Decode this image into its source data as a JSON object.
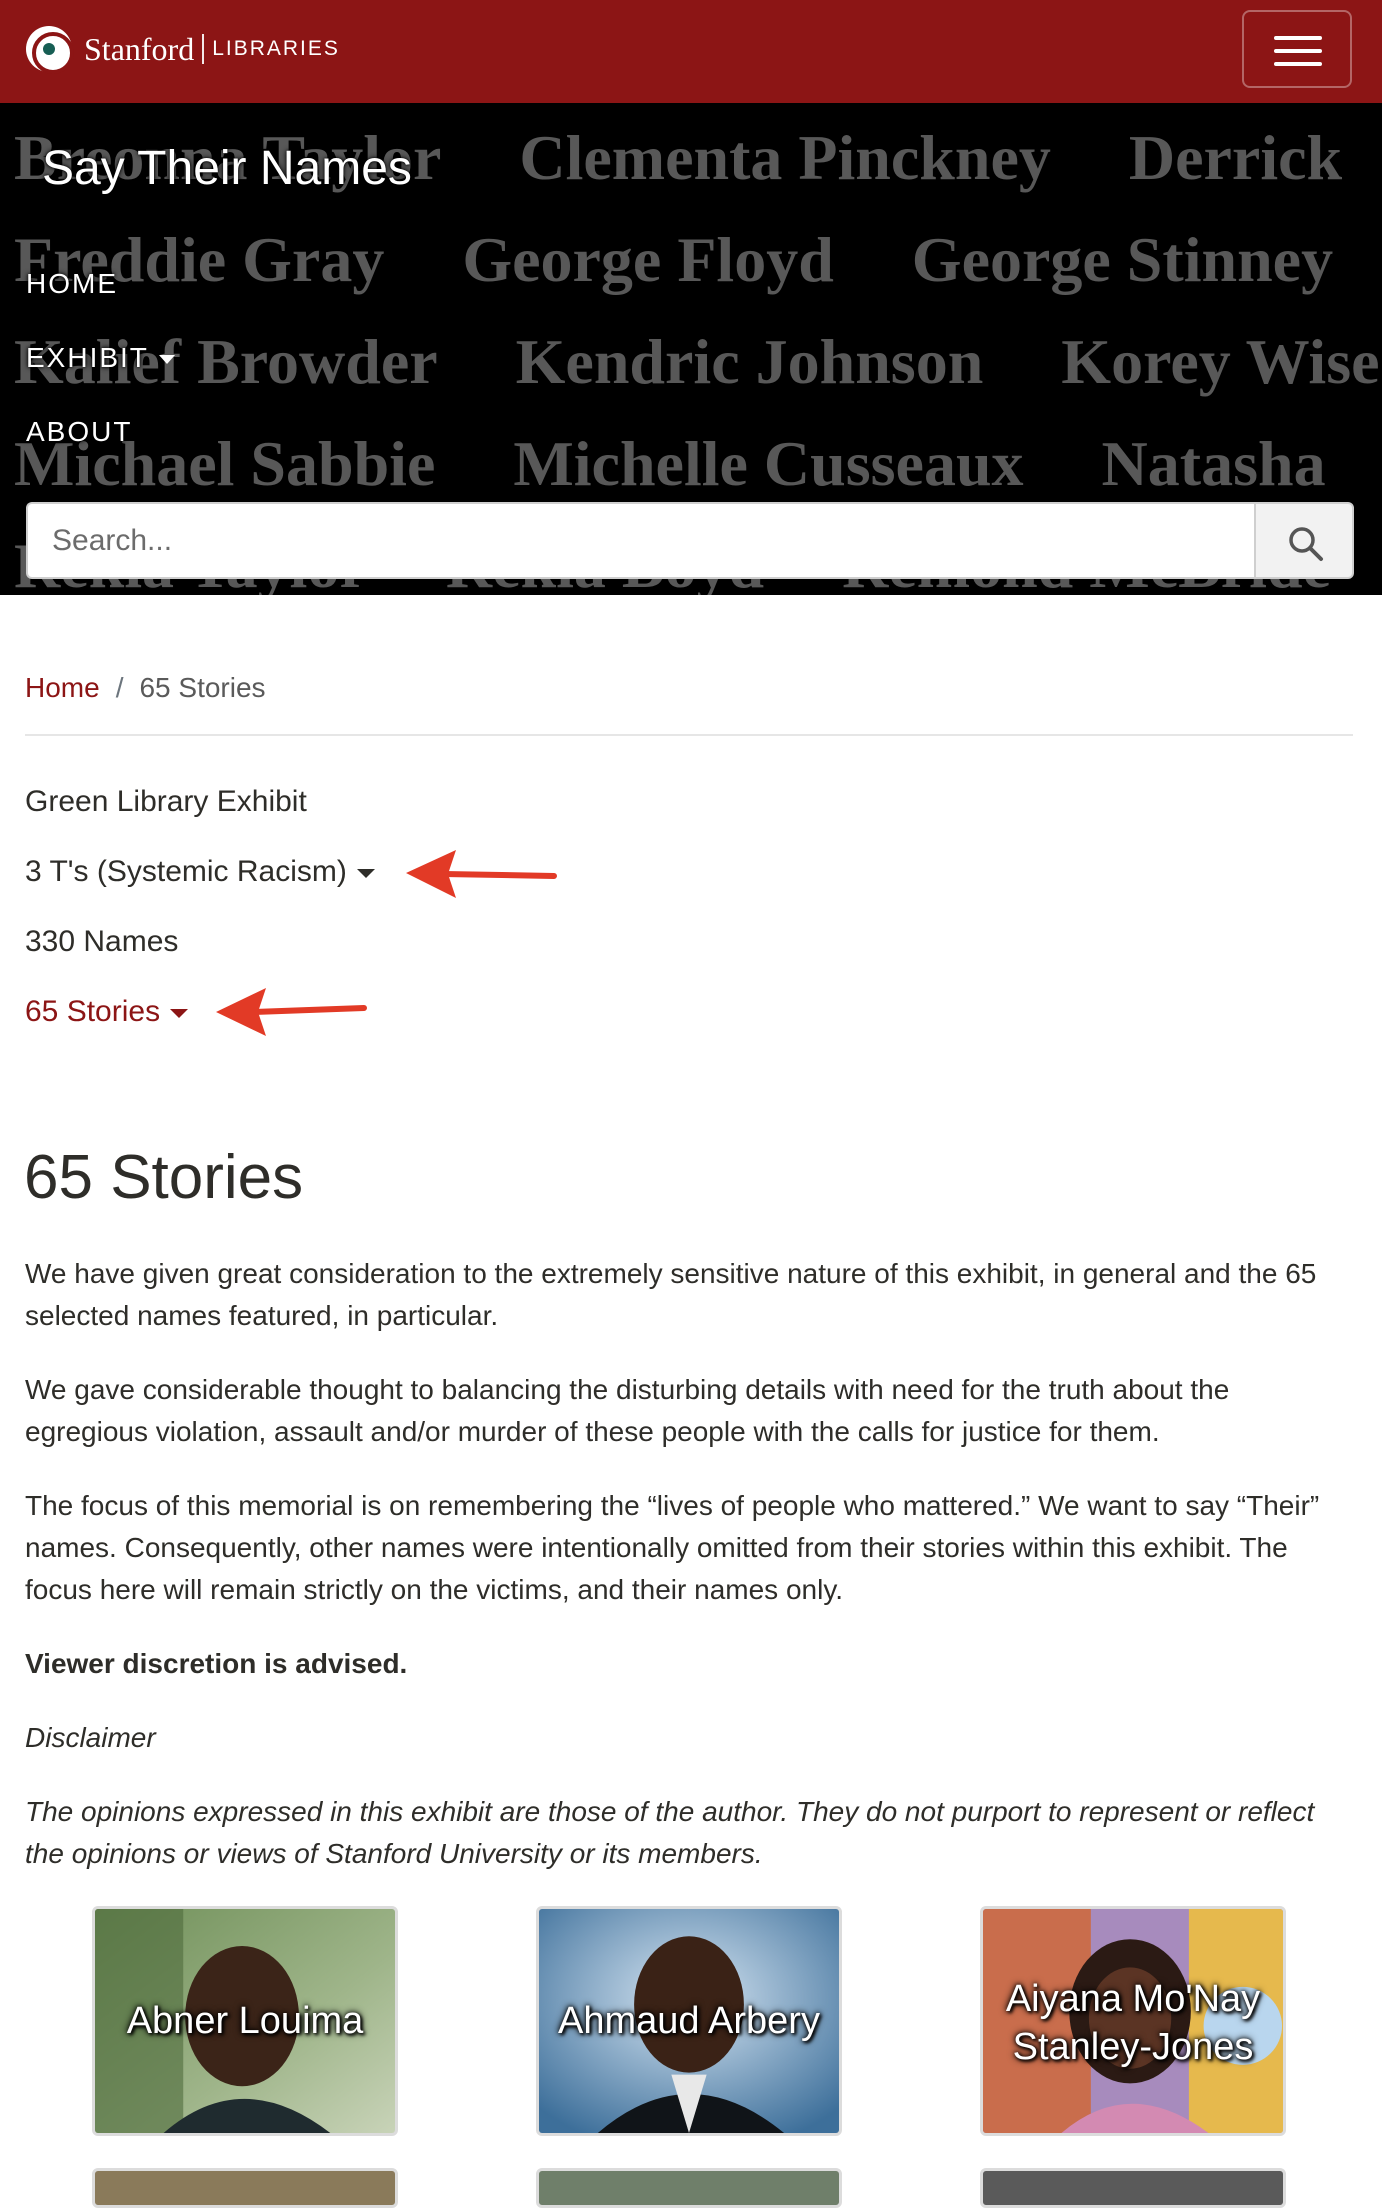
{
  "header": {
    "brand_name": "Stanford",
    "brand_sub": "LIBRARIES",
    "menu_icon": "hamburger-menu-icon",
    "background_color": "#8c1515"
  },
  "hero": {
    "site_title": "Say Their Names",
    "background_names": [
      [
        "Breonna Taylor",
        "Clementa Pinckney",
        "Derrick"
      ],
      [
        "Freddie Gray",
        "George Floyd",
        "George Stinney"
      ],
      [
        "Kalief Browder",
        "Kendric Johnson",
        "Korey Wise"
      ],
      [
        "Michael Sabbie",
        "Michelle Cusseaux",
        "Natasha"
      ],
      [
        "Rekia Taylor",
        "Rekia Boyd",
        "Remond McBride"
      ]
    ],
    "nav": [
      {
        "label": "HOME"
      },
      {
        "label": "EXHIBIT"
      },
      {
        "label": "ABOUT"
      }
    ],
    "search": {
      "placeholder": "Search...",
      "value": ""
    }
  },
  "breadcrumb": {
    "home": "Home",
    "separator": "/",
    "current": "65 Stories"
  },
  "subnav": {
    "items": [
      {
        "label": "Green Library Exhibit"
      },
      {
        "label": "3 T's (Systemic Racism)"
      },
      {
        "label": "330 Names"
      },
      {
        "label": "65 Stories"
      }
    ],
    "active": "65 Stories",
    "accent_color": "#8c1515",
    "annotation_arrow_color": "#e23a26"
  },
  "main": {
    "title": "65 Stories",
    "paragraphs": [
      "We have given great consideration to the extremely sensitive nature of this exhibit, in general and the 65 selected names featured, in particular.",
      "We gave considerable thought to balancing the disturbing details with need for the truth about the egregious violation, assault and/or murder of these people with the calls for justice for them.",
      "The focus of this memorial is on remembering the “lives of people who mattered.” We want to say “Their” names. Consequently, other names were intentionally omitted from their stories within this exhibit. The focus here will remain strictly on the victims, and their names only."
    ],
    "advisory": "Viewer discretion is advised.",
    "disclaimer_heading": "Disclaimer",
    "disclaimer_text": "The opinions expressed in this exhibit are those of the author. They do not purport to represent or reflect the opinions or views of Stanford University or its members."
  },
  "stories": [
    {
      "line1": "Abner Louima",
      "line2": ""
    },
    {
      "line1": "Ahmaud Arbery",
      "line2": ""
    },
    {
      "line1": "Aiyana Mo'Nay",
      "line2": "Stanley-Jones"
    }
  ]
}
